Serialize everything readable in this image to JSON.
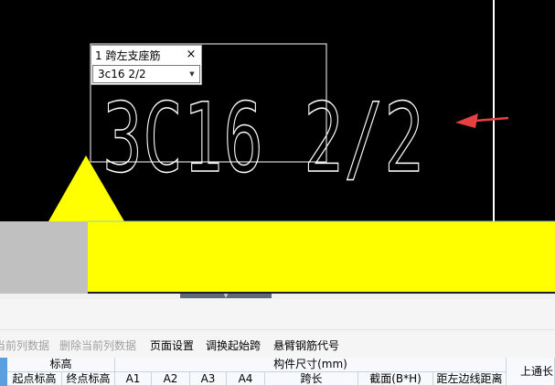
{
  "canvas": {
    "background": "#000000",
    "annotation_text": "3C16 2/2",
    "arrow_color": "#e84040",
    "beam_color": "#ffff00",
    "support_color": "#c0c0c0"
  },
  "popup": {
    "title": "1 跨左支座筋",
    "close_glyph": "×",
    "input_value": "3c16 2/2",
    "dropdown_glyph": "▼"
  },
  "toolbar": {
    "items": [
      {
        "label": "当前列数据",
        "enabled": false
      },
      {
        "label": "删除当前列数据",
        "enabled": false
      },
      {
        "label": "页面设置",
        "enabled": true
      },
      {
        "label": "调换起始跨",
        "enabled": true
      },
      {
        "label": "悬臂钢筋代号",
        "enabled": true
      }
    ]
  },
  "grid": {
    "groups": {
      "elevation": "标高",
      "dimensions": "构件尺寸(mm)"
    },
    "columns": {
      "start_elev": "起点标高",
      "end_elev": "终点标高",
      "a1": "A1",
      "a2": "A2",
      "a3": "A3",
      "a4": "A4",
      "span_length": "跨长",
      "section": "截面(B*H)",
      "left_edge_dist": "距左边线距离",
      "top_through": "上通长"
    }
  }
}
